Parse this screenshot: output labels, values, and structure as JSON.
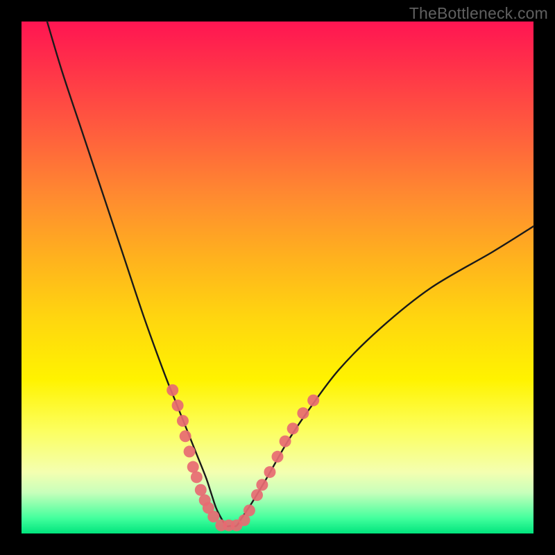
{
  "watermark": "TheBottleneck.com",
  "colors": {
    "frame": "#000000",
    "curve_stroke": "#1a1a1a",
    "dot_fill": "#e76a72",
    "dot_stroke": "#e76a72"
  },
  "chart_data": {
    "type": "line",
    "title": "",
    "xlabel": "",
    "ylabel": "",
    "xlim": [
      0,
      100
    ],
    "ylim": [
      0,
      100
    ],
    "series": [
      {
        "name": "bottleneck-curve",
        "x": [
          5,
          8,
          12,
          16,
          20,
          24,
          28,
          30,
          32,
          34,
          36,
          37,
          38,
          39,
          40,
          41,
          42,
          43,
          45,
          48,
          52,
          56,
          62,
          70,
          80,
          92,
          100
        ],
        "values": [
          100,
          90,
          78,
          66,
          54,
          42,
          31,
          26,
          21,
          16,
          11,
          8,
          5,
          3,
          1.5,
          1.5,
          1.5,
          3,
          6,
          11,
          18,
          24,
          32,
          40,
          48,
          55,
          60
        ]
      }
    ],
    "scatter_points": {
      "name": "highlight-dots",
      "points": [
        {
          "x": 29.5,
          "y": 28
        },
        {
          "x": 30.5,
          "y": 25
        },
        {
          "x": 31.5,
          "y": 22
        },
        {
          "x": 32.0,
          "y": 19
        },
        {
          "x": 32.8,
          "y": 16
        },
        {
          "x": 33.5,
          "y": 13
        },
        {
          "x": 34.2,
          "y": 11
        },
        {
          "x": 35.0,
          "y": 8.5
        },
        {
          "x": 35.8,
          "y": 6.5
        },
        {
          "x": 36.5,
          "y": 5
        },
        {
          "x": 37.5,
          "y": 3.3
        },
        {
          "x": 39.0,
          "y": 1.6
        },
        {
          "x": 40.5,
          "y": 1.6
        },
        {
          "x": 42.0,
          "y": 1.6
        },
        {
          "x": 43.5,
          "y": 2.6
        },
        {
          "x": 44.5,
          "y": 4.5
        },
        {
          "x": 46.0,
          "y": 7.5
        },
        {
          "x": 47.0,
          "y": 9.5
        },
        {
          "x": 48.5,
          "y": 12
        },
        {
          "x": 50.0,
          "y": 15
        },
        {
          "x": 51.5,
          "y": 18
        },
        {
          "x": 53.0,
          "y": 20.5
        },
        {
          "x": 55.0,
          "y": 23.5
        },
        {
          "x": 57.0,
          "y": 26
        }
      ]
    }
  }
}
